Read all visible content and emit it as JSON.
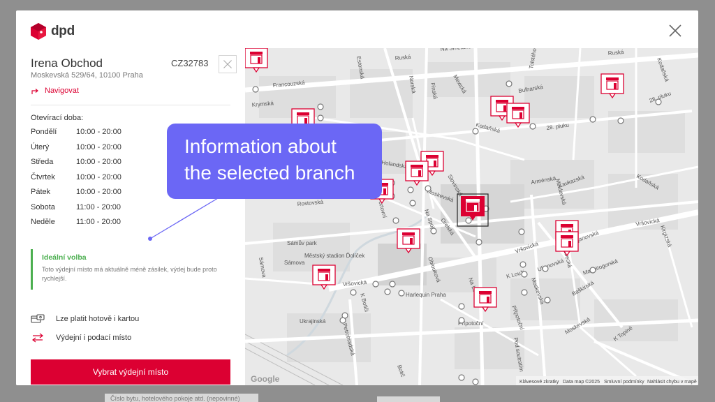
{
  "brand": {
    "name": "dpd",
    "color": "#dc0032"
  },
  "branch": {
    "name": "Irena Obchod",
    "code": "CZ32783",
    "address": "Moskevská 529/64, 10100 Praha",
    "navigate_label": "Navigovat"
  },
  "hours": {
    "title": "Otevírací doba:",
    "rows": [
      {
        "day": "Pondělí",
        "time": "10:00 - 20:00"
      },
      {
        "day": "Úterý",
        "time": "10:00 - 20:00"
      },
      {
        "day": "Středa",
        "time": "10:00 - 20:00"
      },
      {
        "day": "Čtvrtek",
        "time": "10:00 - 20:00"
      },
      {
        "day": "Pátek",
        "time": "10:00 - 20:00"
      },
      {
        "day": "Sobota",
        "time": "11:00 - 20:00"
      },
      {
        "day": "Neděle",
        "time": "11:00 - 20:00"
      }
    ]
  },
  "ideal": {
    "title": "Ideální volba",
    "text": "Toto výdejní místo má aktuálně méně zásilek, výdej bude proto rychlejší."
  },
  "features": [
    {
      "icon": "card-cash-icon",
      "label": "Lze platit hotově i kartou"
    },
    {
      "icon": "swap-arrows-icon",
      "label": "Výdejní i podací místo"
    }
  ],
  "cta_label": "Vybrat výdejní místo",
  "annotation": {
    "line1": "Information about",
    "line2": "the selected branch"
  },
  "map": {
    "streets": [
      "Na Smetance",
      "Ruská",
      "Ruská",
      "Francouzská",
      "Estonská",
      "Norská",
      "Finská",
      "Mexická",
      "Bulharská",
      "Tolstého",
      "Kodaňská",
      "28. pluku",
      "28. pluku",
      "Kodaňská",
      "Krymská",
      "Holandská",
      "Slovinská",
      "Moskevská",
      "Rostovská",
      "Portovní",
      "Na Spojce",
      "Orelská",
      "Arménská",
      "Kavkazská",
      "Vršovická",
      "Vršovická",
      "Moldavská",
      "Uljanovská",
      "Kirgizská",
      "Uljanovská",
      "Uzbecká",
      "Magnitogorská",
      "Baškirská",
      "Oblouková",
      "K Louži",
      "Moskevská",
      "Přípotoční",
      "Přípotoční",
      "Na Louži",
      "Sámova",
      "Sámova",
      "Vršovická",
      "K Botiči",
      "Petrohradská",
      "Ukrajinská",
      "Sámův park",
      "Městský stadion Ďolíček",
      "Harlequin Praha",
      "Moskevská",
      "K Topině",
      "Pod soutratím",
      "Botič",
      "Kodaňská"
    ],
    "attribution": [
      "Klávesové zkratky",
      "Data map ©2025",
      "Smluvní podmínky",
      "Nahlásit chybu v mapě"
    ],
    "google_label": "Google"
  },
  "background": {
    "peek_text": "Číslo bytu, hotelového pokoje atd. (nepovinné)"
  }
}
